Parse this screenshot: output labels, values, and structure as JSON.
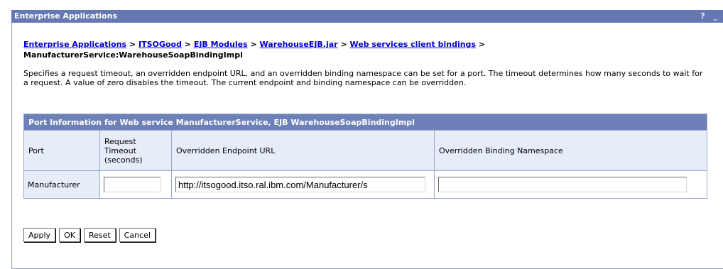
{
  "window": {
    "title": "Enterprise Applications",
    "controls": "? _"
  },
  "breadcrumb": {
    "links": [
      "Enterprise Applications",
      "ITSOGood",
      "EJB Modules",
      "WarehouseEJB.jar",
      "Web services client bindings"
    ],
    "separator": ">",
    "current": "ManufacturerService:WarehouseSoapBindingImpl"
  },
  "description": "Specifies a request timeout, an overridden endpoint URL, and an overridden binding namespace can be set for a port. The timeout determines how many seconds to wait for a request. A value of zero disables the timeout. The current endpoint and binding namespace can be overridden.",
  "table": {
    "caption": "Port Information for Web service ManufacturerService, EJB WarehouseSoapBindingImpl",
    "headers": [
      "Port",
      "Request Timeout (seconds)",
      "Overridden Endpoint URL",
      "Overridden Binding Namespace"
    ],
    "row": {
      "port": "Manufacturer",
      "timeout": "",
      "endpoint_url": "http://itsogood.itso.ral.ibm.com/Manufacturer/s",
      "binding_namespace": ""
    }
  },
  "buttons": {
    "apply": "Apply",
    "ok": "OK",
    "reset": "Reset",
    "cancel": "Cancel"
  }
}
